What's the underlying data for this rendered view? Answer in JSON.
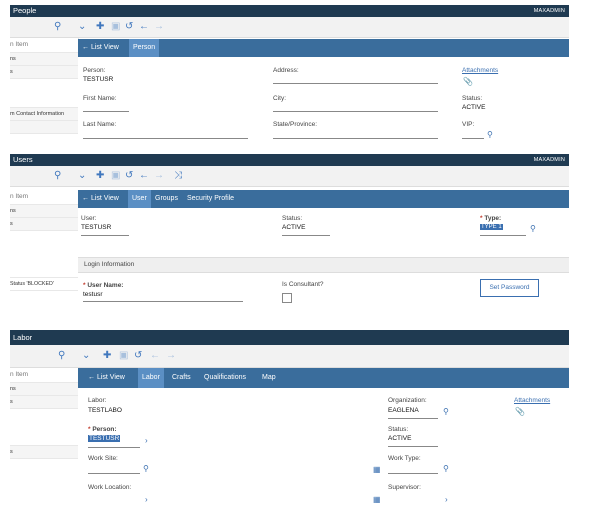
{
  "people": {
    "title": "People",
    "user": "MAXADMIN",
    "side": {
      "header": "n Item",
      "rows": [
        "ns",
        "s",
        "",
        "",
        "",
        "m Contact Information"
      ]
    },
    "tabs": {
      "list": "List View",
      "person": "Person"
    },
    "fields": {
      "person_label": "Person:",
      "person_value": "TESTUSR",
      "firstname_label": "First Name:",
      "lastname_label": "Last Name:",
      "address_label": "Address:",
      "city_label": "City:",
      "state_label": "State/Province:",
      "attachments": "Attachments",
      "status_label": "Status:",
      "status_value": "ACTIVE",
      "vip_label": "VIP:"
    }
  },
  "users": {
    "title": "Users",
    "user": "MAXADMIN",
    "side": {
      "header": "n Item",
      "rows": [
        "ns",
        "s",
        "",
        "",
        "Status 'BLOCKED'",
        ""
      ]
    },
    "tabs": {
      "list": "List View",
      "user": "User",
      "groups": "Groups",
      "security": "Security Profile"
    },
    "fields": {
      "user_label": "User:",
      "user_value": "TESTUSR",
      "status_label": "Status:",
      "status_value": "ACTIVE",
      "type_label": "Type:",
      "type_value": "TYPE 1",
      "section": "Login Information",
      "username_label": "User Name:",
      "username_value": "testusr",
      "consultant_label": "Is Consultant?",
      "set_password": "Set Password"
    }
  },
  "labor": {
    "title": "Labor",
    "side": {
      "header": "n Item",
      "rows": [
        "ns",
        "s",
        "",
        "",
        "s",
        ""
      ]
    },
    "tabs": {
      "list": "List View",
      "labor": "Labor",
      "crafts": "Crafts",
      "qualifications": "Qualifications",
      "map": "Map"
    },
    "fields": {
      "labor_label": "Labor:",
      "labor_value": "TESTLABO",
      "person_label": "Person:",
      "person_value": "TESTUSR",
      "worksite_label": "Work Site:",
      "worklocation_label": "Work Location:",
      "org_label": "Organization:",
      "org_value": "EAGLENA",
      "status_label": "Status:",
      "status_value": "ACTIVE",
      "worktype_label": "Work Type:",
      "supervisor_label": "Supervisor:",
      "attachments": "Attachments"
    }
  }
}
